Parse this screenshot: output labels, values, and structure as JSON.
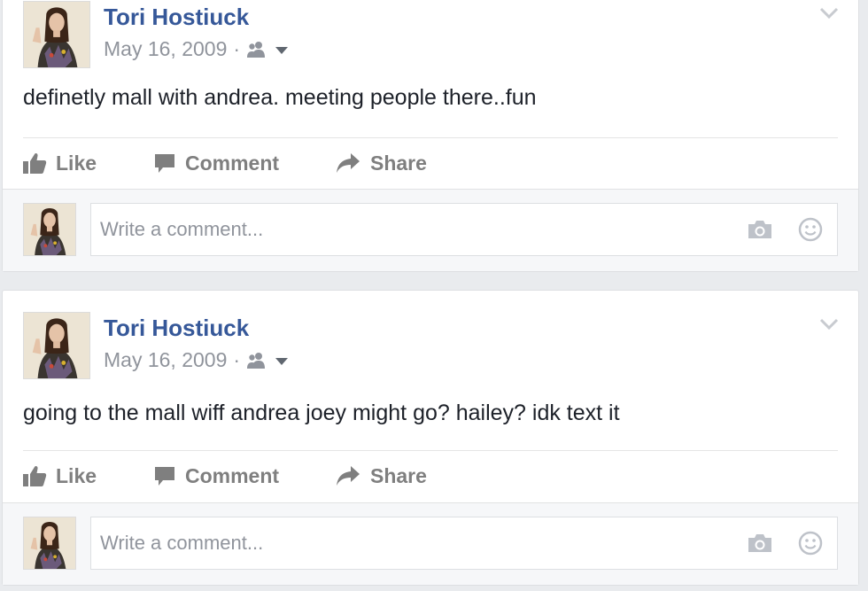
{
  "colors": {
    "page_background": "#e9ebee",
    "author_link": "#365899",
    "meta_text": "#90949c",
    "action_text": "#7f7f7f"
  },
  "icons": {
    "audience": "friends-icon",
    "audience_dropdown": "caret-down-icon",
    "post_menu": "chevron-down-icon",
    "like": "thumbs-up-icon",
    "comment": "speech-bubble-icon",
    "share": "share-arrow-icon",
    "camera": "camera-icon",
    "emoji": "smiley-icon"
  },
  "posts": [
    {
      "author": "Tori Hostiuck",
      "date": "May 16, 2009",
      "separator": "·",
      "text": "definetly mall with andrea. meeting people there..fun",
      "actions": {
        "like": "Like",
        "comment": "Comment",
        "share": "Share"
      },
      "comment_placeholder": "Write a comment..."
    },
    {
      "author": "Tori Hostiuck",
      "date": "May 16, 2009",
      "separator": "·",
      "text": "going to the mall wiff andrea joey might go? hailey? idk text it",
      "actions": {
        "like": "Like",
        "comment": "Comment",
        "share": "Share"
      },
      "comment_placeholder": "Write a comment..."
    }
  ]
}
